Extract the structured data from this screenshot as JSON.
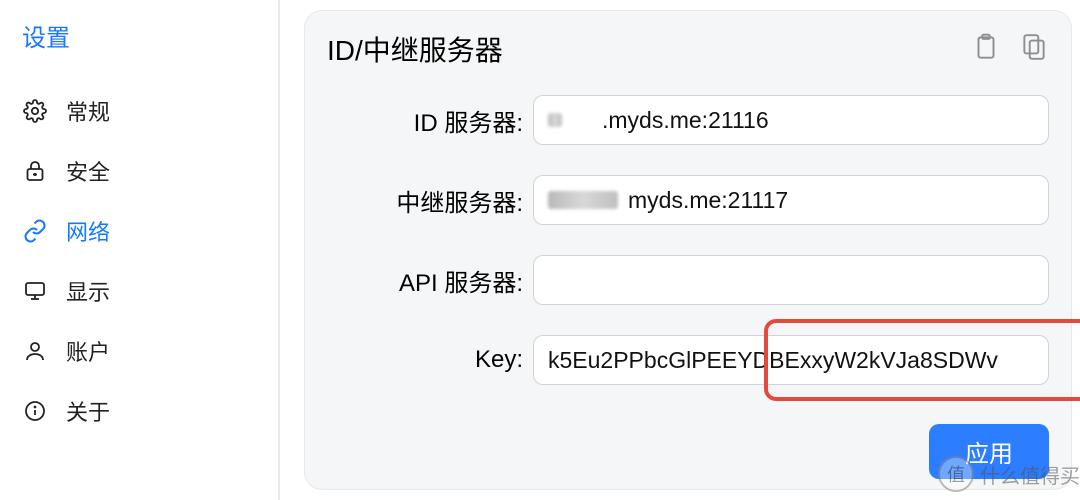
{
  "sidebar": {
    "title": "设置",
    "items": [
      {
        "label": "常规",
        "icon": "gear-icon",
        "active": false
      },
      {
        "label": "安全",
        "icon": "lock-icon",
        "active": false
      },
      {
        "label": "网络",
        "icon": "link-icon",
        "active": true
      },
      {
        "label": "显示",
        "icon": "monitor-icon",
        "active": false
      },
      {
        "label": "账户",
        "icon": "person-icon",
        "active": false
      },
      {
        "label": "关于",
        "icon": "info-icon",
        "active": false
      }
    ]
  },
  "panel": {
    "title": "ID/中继服务器",
    "actions": {
      "paste": "paste-icon",
      "copy": "copy-icon"
    },
    "fields": {
      "id_server": {
        "label": "ID 服务器:",
        "value_visible": ".myds.me:21116",
        "obscured_prefix": true
      },
      "relay_server": {
        "label": "中继服务器:",
        "value_visible": "myds.me:21117",
        "obscured_prefix": true
      },
      "api_server": {
        "label": "API 服务器:",
        "value_visible": "",
        "obscured_prefix": false
      },
      "key": {
        "label": "Key:",
        "value_visible": "k5Eu2PPbcGlPEEYDBExxyW2kVJa8SDWv",
        "obscured_prefix": false,
        "highlighted": true
      }
    },
    "apply_label": "应用"
  },
  "watermark": {
    "badge": "值",
    "text": "什么值得买"
  }
}
